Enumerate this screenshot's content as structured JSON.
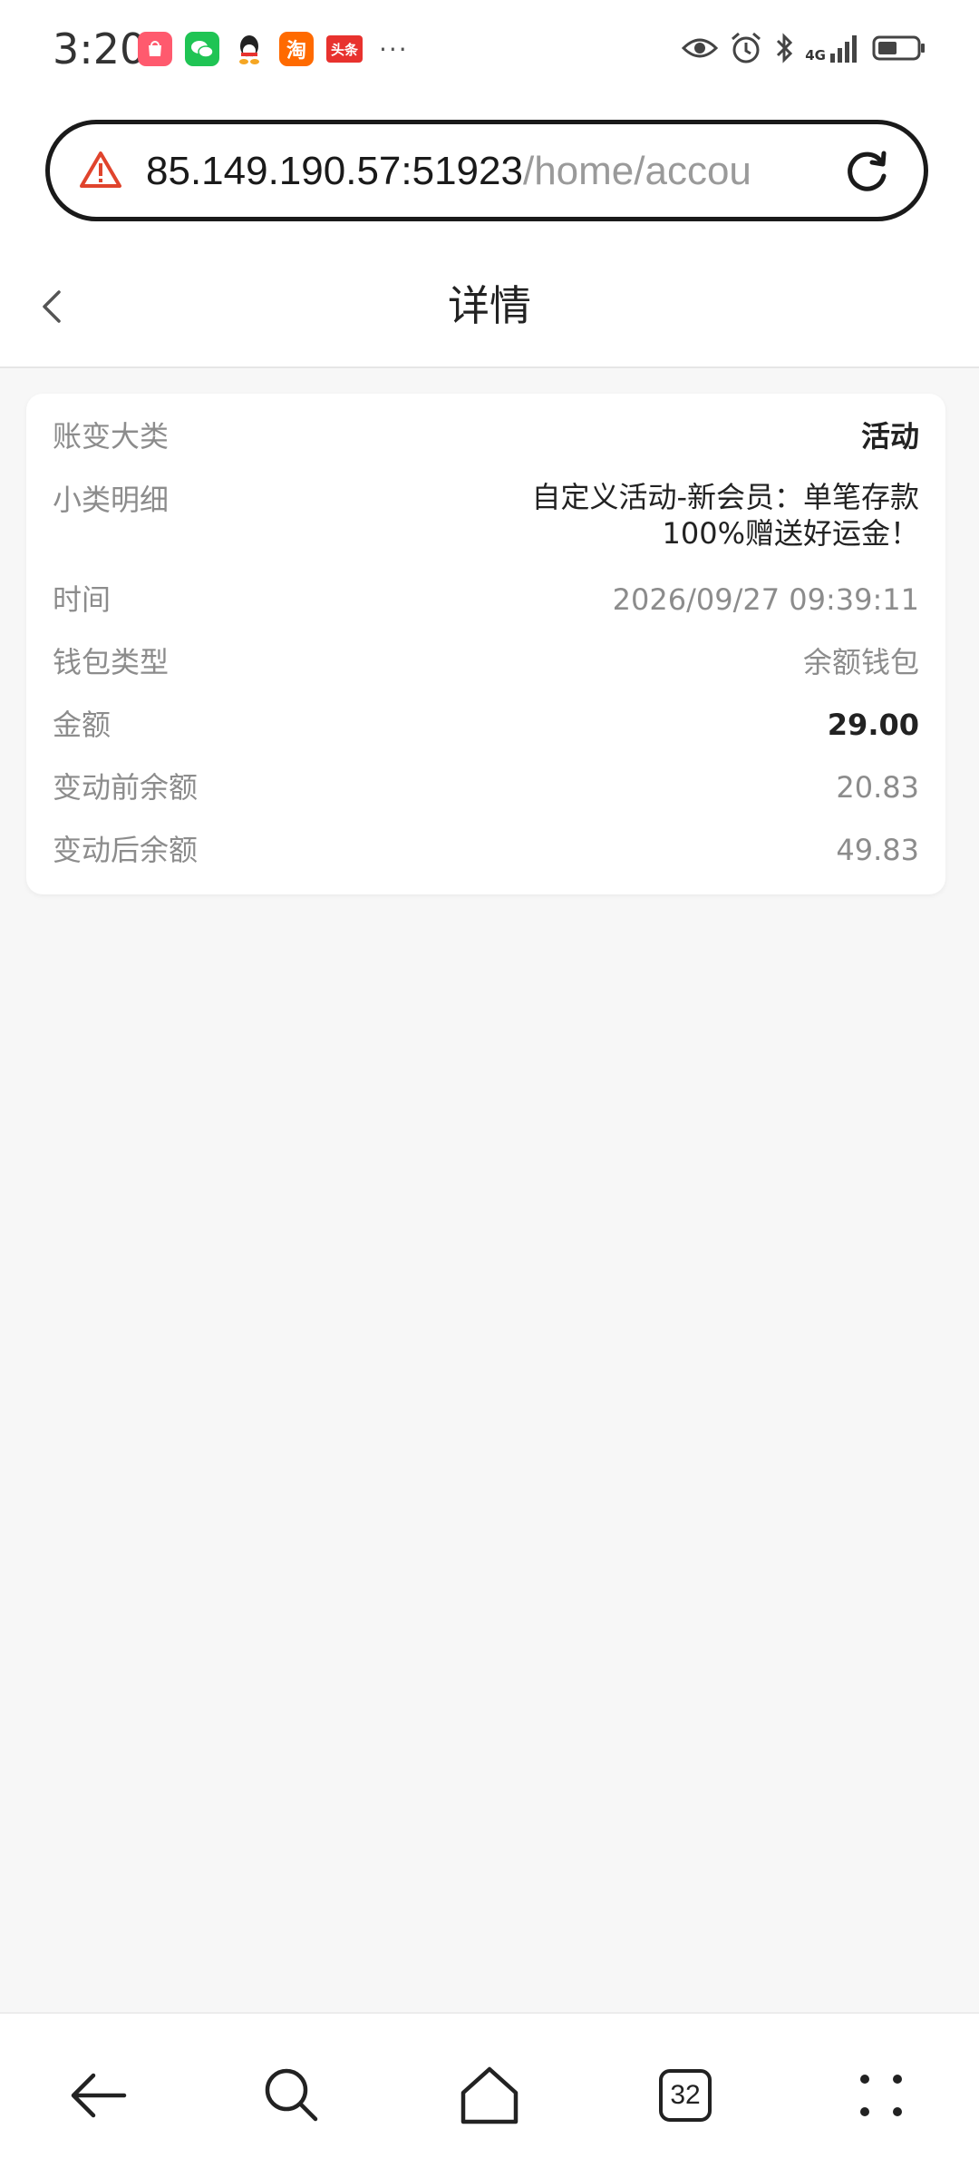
{
  "status_bar": {
    "time": "3:20",
    "apps": [
      "shopping-bag-icon",
      "wechat-icon",
      "qq-icon",
      "taobao-icon",
      "toutiao-icon"
    ],
    "taobao_label": "淘",
    "toutiao_label": "头条",
    "more": "···",
    "network": "4G"
  },
  "browser": {
    "url_host": "85.149.190.57:51923",
    "url_path": "/home/accou",
    "tab_count": "32"
  },
  "page": {
    "title": "详情"
  },
  "details": [
    {
      "label": "账变大类",
      "value": "活动"
    },
    {
      "label": "小类明细",
      "value_line1": "自定义活动-新会员：单笔存款",
      "value_line2": "100%赠送好运金！"
    },
    {
      "label": "时间",
      "value": "2026/09/27 09:39:11"
    },
    {
      "label": "钱包类型",
      "value": "余额钱包"
    },
    {
      "label": "金额",
      "value": "29.00"
    },
    {
      "label": "变动前余额",
      "value": "20.83"
    },
    {
      "label": "变动后余额",
      "value": "49.83"
    }
  ],
  "colors": {
    "accent_warning": "#e0442d",
    "label_gray": "#8c8c8c",
    "value_dark": "#222222",
    "background": "#f7f7f7"
  }
}
